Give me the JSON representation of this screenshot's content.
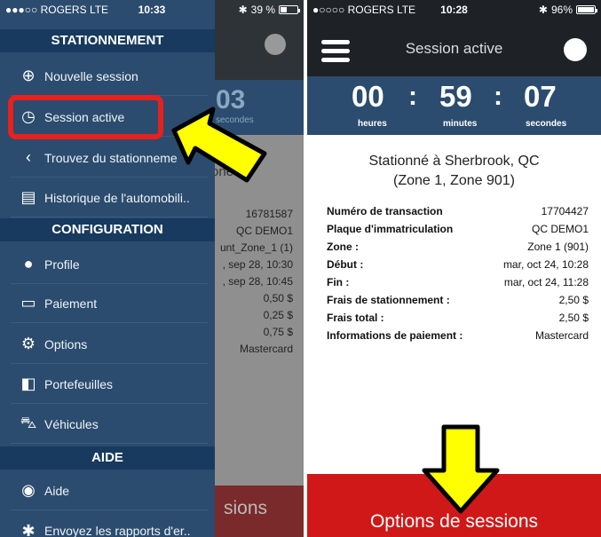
{
  "left": {
    "status": {
      "carrier": "ROGERS",
      "network": "LTE",
      "time": "10:33",
      "battery": "39 %"
    },
    "background": {
      "timer_value": "03",
      "timer_unit": "secondes",
      "zone_text": "one 1)",
      "values": [
        "16781587",
        "QC DEMO1",
        "unt_Zone_1 (1)",
        ", sep 28, 10:30",
        ", sep 28, 10:45",
        "0,50 $",
        "0,25 $",
        "0,75 $",
        "Mastercard"
      ],
      "footer_text": "sions"
    },
    "drawer": {
      "sections": [
        "STATIONNEMENT",
        "CONFIGURATION",
        "AIDE"
      ],
      "items": [
        {
          "label": "Nouvelle session",
          "icon": "parking-plus-icon"
        },
        {
          "label": "Session active",
          "icon": "parking-clock-icon"
        },
        {
          "label": "Trouvez du stationneme",
          "icon": "location-arrow-icon"
        },
        {
          "label": "Historique de l'automobili..",
          "icon": "receipt-icon"
        },
        {
          "label": "Profile",
          "icon": "profile-icon"
        },
        {
          "label": "Paiement",
          "icon": "credit-card-icon"
        },
        {
          "label": "Options",
          "icon": "gears-icon"
        },
        {
          "label": "Portefeuilles",
          "icon": "wallet-icon"
        },
        {
          "label": "Véhicules",
          "icon": "car-icon"
        },
        {
          "label": "Aide",
          "icon": "lifebuoy-icon"
        },
        {
          "label": "Envoyez les rapports d'er..",
          "icon": "bug-icon"
        }
      ]
    }
  },
  "right": {
    "status": {
      "carrier": "ROGERS",
      "network": "LTE",
      "time": "10:28",
      "battery": "96%"
    },
    "title": "Session active",
    "timer": {
      "hours": "00",
      "minutes": "59",
      "seconds": "07",
      "hours_label": "heures",
      "minutes_label": "minutes",
      "seconds_label": "secondes",
      "sep": ":"
    },
    "location_line1": "Stationné à Sherbrook, QC",
    "location_line2": "(Zone 1, Zone 901)",
    "details": [
      {
        "key": "Numéro de transaction",
        "value": "17704427"
      },
      {
        "key": "Plaque d'immatriculation",
        "value": "QC DEMO1"
      },
      {
        "key": "Zone :",
        "value": "Zone 1 (901)"
      },
      {
        "key": "Début :",
        "value": "mar, oct 24, 10:28"
      },
      {
        "key": "Fin :",
        "value": "mar, oct 24, 11:28"
      },
      {
        "key": "Frais de stationnement :",
        "value": "2,50 $"
      },
      {
        "key": "Frais total :",
        "value": "2,50 $"
      },
      {
        "key": "Informations de paiement :",
        "value": "Mastercard"
      }
    ],
    "footer_button": "Options de sessions"
  },
  "colors": {
    "drawer": "#2b4c6e",
    "section": "#173a5e",
    "highlight": "#e8201e",
    "arrow": "#ffff00",
    "footer": "#d01818"
  }
}
